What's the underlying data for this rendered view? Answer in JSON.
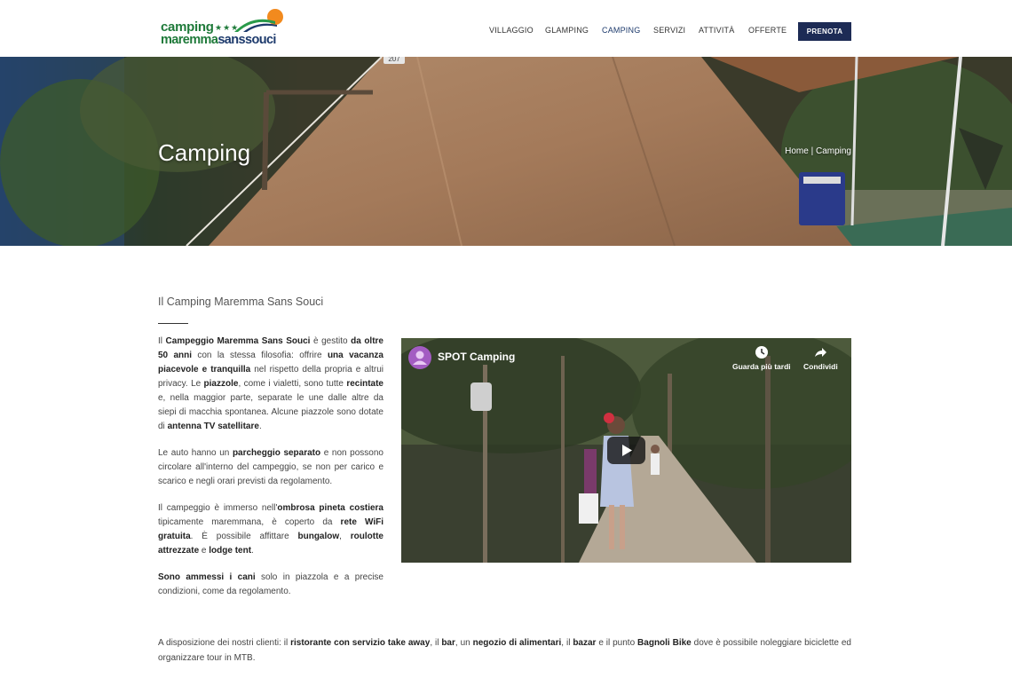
{
  "logo": {
    "line1": "camping",
    "stars": "★★★",
    "line2a": "maremma",
    "line2b": "sanssouci"
  },
  "nav": {
    "items": [
      {
        "label": "VILLAGGIO"
      },
      {
        "label": "GLAMPING"
      },
      {
        "label": "CAMPING"
      },
      {
        "label": "SERVIZI"
      },
      {
        "label": "ATTIVITÀ"
      },
      {
        "label": "OFFERTE"
      }
    ],
    "cta": "PRENOTA"
  },
  "hero": {
    "title": "Camping",
    "breadcrumb": {
      "home": "Home",
      "sep": "|",
      "current": "Camping"
    },
    "tent_number": "207"
  },
  "main": {
    "section_title": "Il Camping Maremma Sans Souci",
    "p1": [
      {
        "t": "Il "
      },
      {
        "t": "Campeggio Maremma Sans Souci",
        "b": 1
      },
      {
        "t": " è gestito "
      },
      {
        "t": "da oltre 50 anni",
        "b": 1
      },
      {
        "t": " con la stessa filosofia: offrire "
      },
      {
        "t": "una vacanza piacevole e tranquilla",
        "b": 1
      },
      {
        "t": " nel rispetto della propria e altrui privacy. Le "
      },
      {
        "t": "piazzole",
        "b": 1
      },
      {
        "t": ", come i vialetti, sono tutte "
      },
      {
        "t": "recintate",
        "b": 1
      },
      {
        "t": " e, nella maggior parte, separate le une dalle altre da siepi di macchia spontanea. Alcune piazzole sono dotate di "
      },
      {
        "t": "antenna TV satellitare",
        "b": 1
      },
      {
        "t": "."
      }
    ],
    "p2": [
      {
        "t": "Le auto hanno un "
      },
      {
        "t": "parcheggio separato",
        "b": 1
      },
      {
        "t": " e non possono circolare all'interno del campeggio, se non per carico e scarico e negli orari previsti da regolamento."
      }
    ],
    "p3": [
      {
        "t": "Il campeggio è immerso nell'"
      },
      {
        "t": "ombrosa pineta costiera",
        "b": 1
      },
      {
        "t": " tipicamente maremmana, è coperto da "
      },
      {
        "t": "rete WiFi gratuita",
        "b": 1
      },
      {
        "t": ". È possibile affittare "
      },
      {
        "t": "bungalow",
        "b": 1
      },
      {
        "t": ", "
      },
      {
        "t": "roulotte attrezzate",
        "b": 1
      },
      {
        "t": " e "
      },
      {
        "t": "lodge tent",
        "b": 1
      },
      {
        "t": "."
      }
    ],
    "p4": [
      {
        "t": "Sono ammessi i cani",
        "b": 1
      },
      {
        "t": " solo in piazzola e a precise condizioni, come da regolamento."
      }
    ],
    "bottom": [
      {
        "t": "A disposizione dei nostri clienti: il "
      },
      {
        "t": "ristorante con servizio take away",
        "b": 1
      },
      {
        "t": ", il "
      },
      {
        "t": "bar",
        "b": 1
      },
      {
        "t": ", un "
      },
      {
        "t": "negozio di alimentari",
        "b": 1
      },
      {
        "t": ", il "
      },
      {
        "t": "bazar",
        "b": 1
      },
      {
        "t": " e il punto "
      },
      {
        "t": "Bagnoli Bike",
        "b": 1
      },
      {
        "t": " dove è possibile noleggiare biciclette ed organizzare tour in MTB."
      }
    ]
  },
  "video": {
    "title": "SPOT Camping",
    "watch_later": "Guarda più tardi",
    "share": "Condividi",
    "channel_icon": "user-icon",
    "play_icon": "play-icon"
  },
  "colors": {
    "brand_green": "#1f7a3a",
    "brand_navy": "#1d2b55"
  }
}
